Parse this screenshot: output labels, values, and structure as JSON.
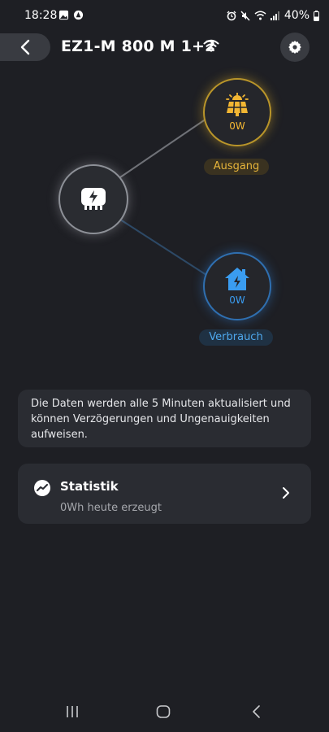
{
  "status_bar": {
    "time": "18:28",
    "battery": "40%",
    "left_icons": [
      "image-icon",
      "app-icon"
    ],
    "right_icons": [
      "alarm-icon",
      "mute-icon",
      "wifi-icon",
      "signal-icon",
      "battery-icon"
    ]
  },
  "header": {
    "title": "EZ1-M 800 M 1+2"
  },
  "diagram": {
    "solar": {
      "value": "0W",
      "label": "Ausgang"
    },
    "home": {
      "value": "0W",
      "label": "Verbrauch"
    }
  },
  "info": {
    "text": "Die Daten werden alle 5 Minuten aktualisiert und können Verzögerungen und Ungenauigkeiten aufweisen."
  },
  "statistics": {
    "title": "Statistik",
    "subtitle": "0Wh heute erzeugt"
  },
  "colors": {
    "background": "#1e1f24",
    "solar": "#f2b633",
    "home": "#3a9cf0",
    "card": "#2a2c32"
  }
}
